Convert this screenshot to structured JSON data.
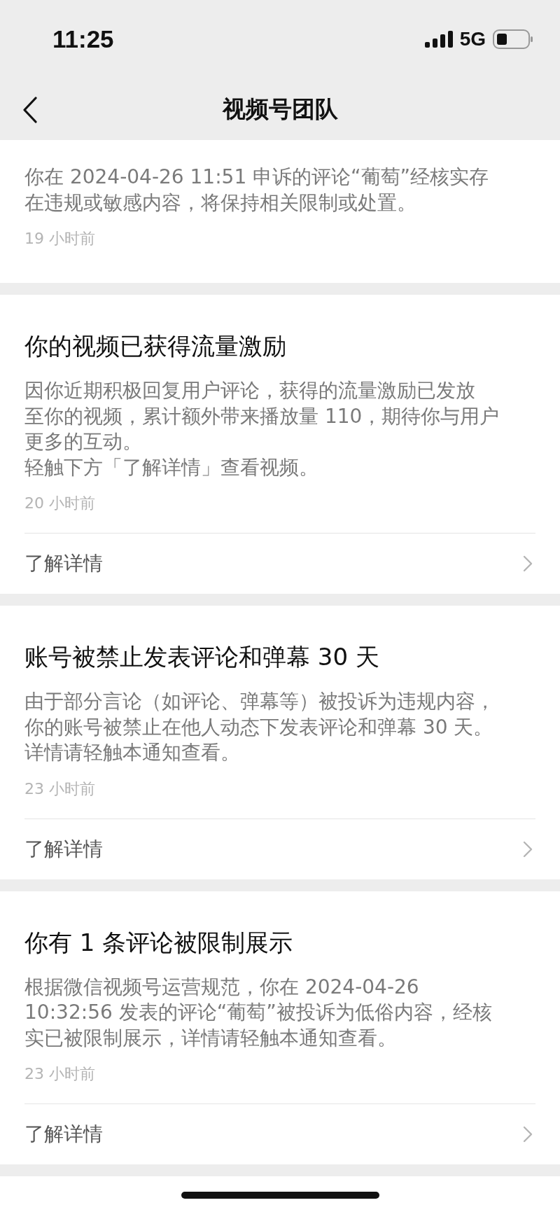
{
  "status_bar": {
    "time": "11:25",
    "network": "5G"
  },
  "nav": {
    "title": "视频号团队"
  },
  "notifications": [
    {
      "body": [
        "你在 2024-04-26 11:51 申诉的评论“葡萄”经核实存",
        "在违规或敏感内容，将保持相关限制或处置。"
      ],
      "time": "19 小时前"
    },
    {
      "title": "你的视频已获得流量激励",
      "body": [
        "因你近期积极回复用户评论，获得的流量激励已发放",
        "至你的视频，累计额外带来播放量 110，期待你与用户",
        "更多的互动。",
        "轻触下方「了解详情」查看视频。"
      ],
      "time": "20 小时前",
      "link": "了解详情"
    },
    {
      "title": "账号被禁止发表评论和弹幕 30 天",
      "body": [
        "由于部分言论（如评论、弹幕等）被投诉为违规内容，",
        "你的账号被禁止在他人动态下发表评论和弹幕 30 天。",
        "详情请轻触本通知查看。"
      ],
      "time": "23 小时前",
      "link": "了解详情"
    },
    {
      "title": "你有 1 条评论被限制展示",
      "body": [
        "根据微信视频号运营规范，你在 2024-04-26",
        "10:32:56 发表的评论“葡萄”被投诉为低俗内容，经核",
        "实已被限制展示，详情请轻触本通知查看。"
      ],
      "time": "23 小时前",
      "link": "了解详情"
    }
  ]
}
